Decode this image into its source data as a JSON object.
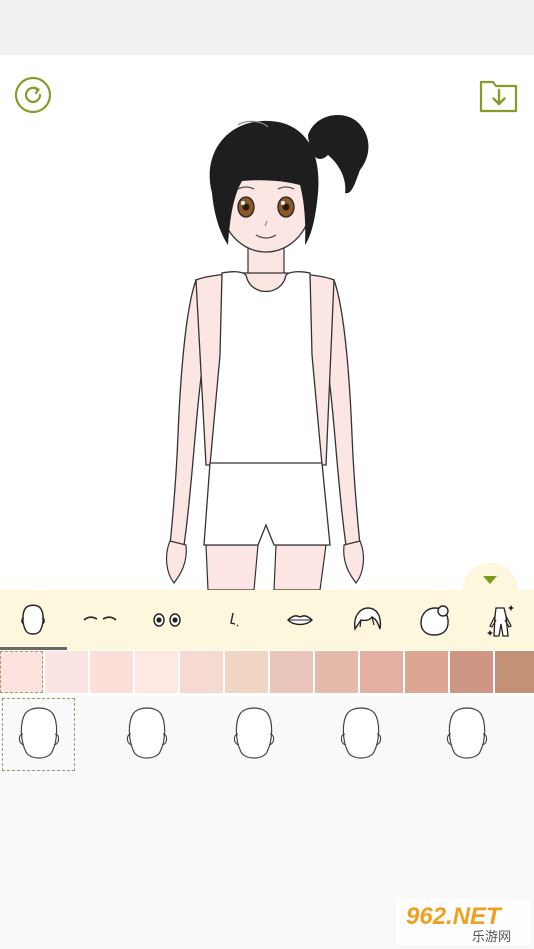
{
  "toolbar": {
    "reset_icon": "refresh-icon",
    "save_icon": "download-icon"
  },
  "panel": {
    "toggle_icon": "triangle-down-icon",
    "categories": [
      {
        "name": "face",
        "icon": "face-outline-icon",
        "active": true
      },
      {
        "name": "eyebrows",
        "icon": "eyebrows-icon",
        "active": false
      },
      {
        "name": "eyes",
        "icon": "eyes-icon",
        "active": false
      },
      {
        "name": "nose",
        "icon": "nose-icon",
        "active": false
      },
      {
        "name": "mouth",
        "icon": "lips-icon",
        "active": false
      },
      {
        "name": "hair",
        "icon": "hair-icon",
        "active": false
      },
      {
        "name": "back-hair",
        "icon": "bun-hair-icon",
        "active": false
      },
      {
        "name": "outfit",
        "icon": "outfit-icon",
        "active": false
      }
    ],
    "skin_tones": [
      "#fde3df",
      "#fbe4e3",
      "#fddfd9",
      "#fde9e2",
      "#f6dad1",
      "#f0d5c3",
      "#e9c6b9",
      "#e6baab",
      "#e2b0a2",
      "#dca693",
      "#cf9783",
      "#c39176"
    ],
    "selected_tone_index": 0,
    "face_options_count": 5,
    "selected_face_index": 0
  },
  "watermark": {
    "brand": "962.NET",
    "subtitle": "乐游网"
  }
}
